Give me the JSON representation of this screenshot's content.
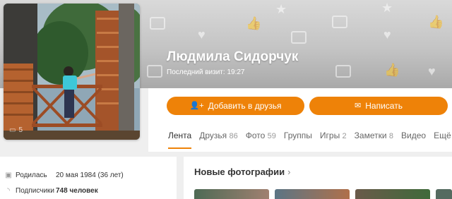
{
  "profile": {
    "name": "Людмила Сидорчук",
    "last_visit": "Последний визит: 19:27",
    "avatar_badge_count": "5"
  },
  "actions": {
    "add_friend": "Добавить в друзья",
    "write": "Написать",
    "add_icon": "add-user-icon",
    "write_icon": "envelope-icon"
  },
  "tabs": [
    {
      "label": "Лента",
      "count": ""
    },
    {
      "label": "Друзья",
      "count": "86"
    },
    {
      "label": "Фото",
      "count": "59"
    },
    {
      "label": "Группы",
      "count": ""
    },
    {
      "label": "Игры",
      "count": "2"
    },
    {
      "label": "Заметки",
      "count": "8"
    },
    {
      "label": "Видео",
      "count": ""
    },
    {
      "label": "Ещё",
      "count": ""
    }
  ],
  "info": {
    "birth_label": "Родилась",
    "birth_value": "20 мая 1984 (36 лет)",
    "subs_label": "Подписчики",
    "subs_value": "748 человек"
  },
  "photos": {
    "title": "Новые фотографии"
  },
  "colors": {
    "accent": "#ee8208",
    "cover": "#c4c4c4",
    "background": "#efefef"
  }
}
